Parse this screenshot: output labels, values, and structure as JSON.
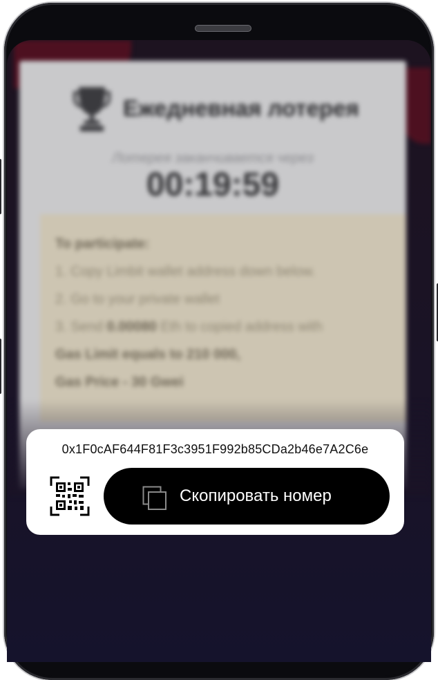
{
  "lottery": {
    "title": "Ежедневная лотерея",
    "timer_label": "Лотерея заканчивается через",
    "timer": "00:19:59"
  },
  "instructions": {
    "heading": "To participate:",
    "step1": "1. Copy Limbit wallet address down below.",
    "step2": "2. Go to your private wallet",
    "step3_prefix": "3. Send ",
    "step3_amount": "0.00080",
    "step3_suffix": " Eth to copied address with",
    "gas_limit": "Gas Limit equals to 210 000,",
    "gas_price": "Gas Price - 30 Gwei"
  },
  "wallet": {
    "address": "0x1F0cAF644F81F3c3951F992b85CDa2b46e7A2C6e",
    "copy_label": "Скопировать номер"
  },
  "icons": {
    "trophy": "trophy-icon",
    "qr": "qr-code-icon",
    "copy": "copy-icon"
  },
  "colors": {
    "panel_bg": "#ffffff",
    "button_bg": "#000000",
    "button_text": "#ffffff",
    "instructions_bg": "#cdc5b2"
  }
}
